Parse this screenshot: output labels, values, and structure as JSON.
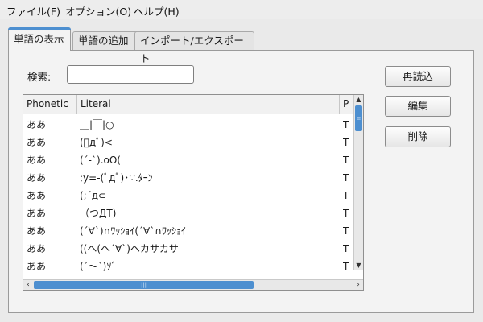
{
  "menu": [
    {
      "label": "ファイル(F)",
      "name": "menu-file"
    },
    {
      "label": "オプション(O)",
      "name": "menu-options"
    },
    {
      "label": "ヘルプ(H)",
      "name": "menu-help"
    }
  ],
  "tabs": [
    {
      "label": "単語の表示",
      "active": true
    },
    {
      "label": "単語の追加",
      "active": false
    },
    {
      "label": "インポート/エクスポート",
      "active": false
    }
  ],
  "search": {
    "label": "検索:",
    "value": ""
  },
  "buttons": {
    "reload": "再読込",
    "edit": "編集",
    "delete": "削除"
  },
  "list": {
    "columns": [
      "Phonetic",
      "Literal",
      "P"
    ],
    "rows": [
      {
        "phonetic": "ああ",
        "literal": "＿|￣|○",
        "p": "T"
      },
      {
        "phonetic": "ああ",
        "literal": "(ﾟдﾟ)<",
        "p": "T"
      },
      {
        "phonetic": "ああ",
        "literal": "(´-`).oO(",
        "p": "T"
      },
      {
        "phonetic": "ああ",
        "literal": ";y=-(ﾟдﾟ)･∵.ﾀｰﾝ",
        "p": "T"
      },
      {
        "phonetic": "ああ",
        "literal": "(;´д⊂",
        "p": "T"
      },
      {
        "phonetic": "ああ",
        "literal": "（つДT)",
        "p": "T"
      },
      {
        "phonetic": "ああ",
        "literal": "(´∀`)∩ﾜｯｼｮｲ(´∀`∩ﾜｯｼｮｲ",
        "p": "T"
      },
      {
        "phonetic": "ああ",
        "literal": "((ヘ(ヘ´∀`)ヘカサカサ",
        "p": "T"
      },
      {
        "phonetic": "ああ",
        "literal": "(´～`)ｿﾞ",
        "p": "T"
      }
    ]
  },
  "colors": {
    "accent": "#4d8fd0",
    "panel": "#f3f3f3",
    "background": "#eaeaea"
  },
  "icons": {
    "scroll_up": "▲",
    "scroll_down": "▼",
    "scroll_left": "‹",
    "scroll_right": "›",
    "grip": "≡",
    "grip_h": "|||"
  }
}
